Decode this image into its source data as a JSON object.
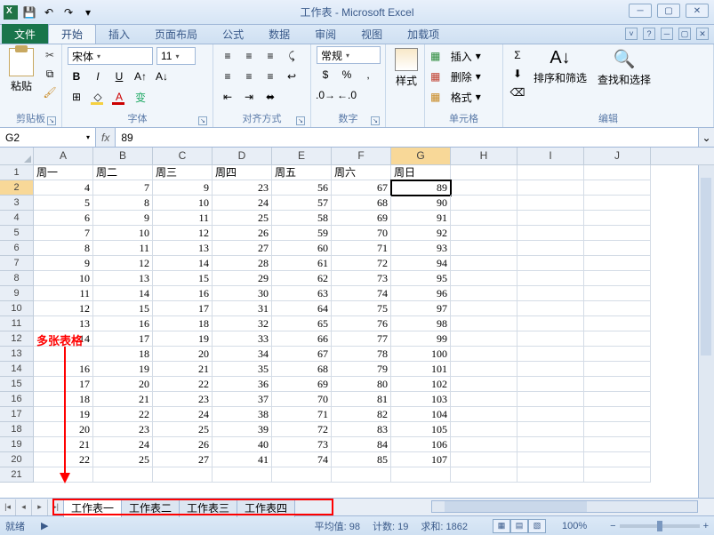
{
  "title": "工作表 - Microsoft Excel",
  "qat": {
    "save": "💾",
    "undo": "↶",
    "redo": "↷"
  },
  "tabs": {
    "file": "文件",
    "home": "开始",
    "insert": "插入",
    "layout": "页面布局",
    "formula": "公式",
    "data": "数据",
    "review": "审阅",
    "view": "视图",
    "addin": "加载项"
  },
  "ribbon": {
    "clipboard": {
      "label": "剪贴板",
      "paste": "粘贴"
    },
    "font": {
      "label": "字体",
      "name": "宋体",
      "size": "11"
    },
    "align": {
      "label": "对齐方式"
    },
    "number": {
      "label": "数字",
      "format": "常规"
    },
    "styles": {
      "label": "",
      "stylebtn": "样式"
    },
    "cells": {
      "label": "单元格",
      "insert": "插入",
      "delete": "删除",
      "format": "格式"
    },
    "editing": {
      "label": "编辑",
      "sort": "排序和筛选",
      "find": "查找和选择",
      "sum": "Σ"
    }
  },
  "namebox": "G2",
  "formula": "89",
  "columns": [
    "A",
    "B",
    "C",
    "D",
    "E",
    "F",
    "G",
    "H",
    "I",
    "J"
  ],
  "headers": [
    "周一",
    "周二",
    "周三",
    "周四",
    "周五",
    "周六",
    "周日"
  ],
  "rows": [
    [
      4,
      7,
      9,
      23,
      56,
      67,
      89
    ],
    [
      5,
      8,
      10,
      24,
      57,
      68,
      90
    ],
    [
      6,
      9,
      11,
      25,
      58,
      69,
      91
    ],
    [
      7,
      10,
      12,
      26,
      59,
      70,
      92
    ],
    [
      8,
      11,
      13,
      27,
      60,
      71,
      93
    ],
    [
      9,
      12,
      14,
      28,
      61,
      72,
      94
    ],
    [
      10,
      13,
      15,
      29,
      62,
      73,
      95
    ],
    [
      11,
      14,
      16,
      30,
      63,
      74,
      96
    ],
    [
      12,
      15,
      17,
      31,
      64,
      75,
      97
    ],
    [
      13,
      16,
      18,
      32,
      65,
      76,
      98
    ],
    [
      14,
      17,
      19,
      33,
      66,
      77,
      99
    ],
    [
      "",
      18,
      20,
      34,
      67,
      78,
      100
    ],
    [
      16,
      19,
      21,
      35,
      68,
      79,
      101
    ],
    [
      17,
      20,
      22,
      36,
      69,
      80,
      102
    ],
    [
      18,
      21,
      23,
      37,
      70,
      81,
      103
    ],
    [
      19,
      22,
      24,
      38,
      71,
      82,
      104
    ],
    [
      20,
      23,
      25,
      39,
      72,
      83,
      105
    ],
    [
      21,
      24,
      26,
      40,
      73,
      84,
      106
    ],
    [
      22,
      25,
      27,
      41,
      74,
      85,
      107
    ]
  ],
  "annotation": "多张表格",
  "sheets": [
    "工作表一",
    "工作表二",
    "工作表三",
    "工作表四"
  ],
  "status": {
    "ready": "就绪",
    "avg_label": "平均值:",
    "avg": "98",
    "count_label": "计数:",
    "count": "19",
    "sum_label": "求和:",
    "sum": "1862",
    "zoom": "100%"
  }
}
